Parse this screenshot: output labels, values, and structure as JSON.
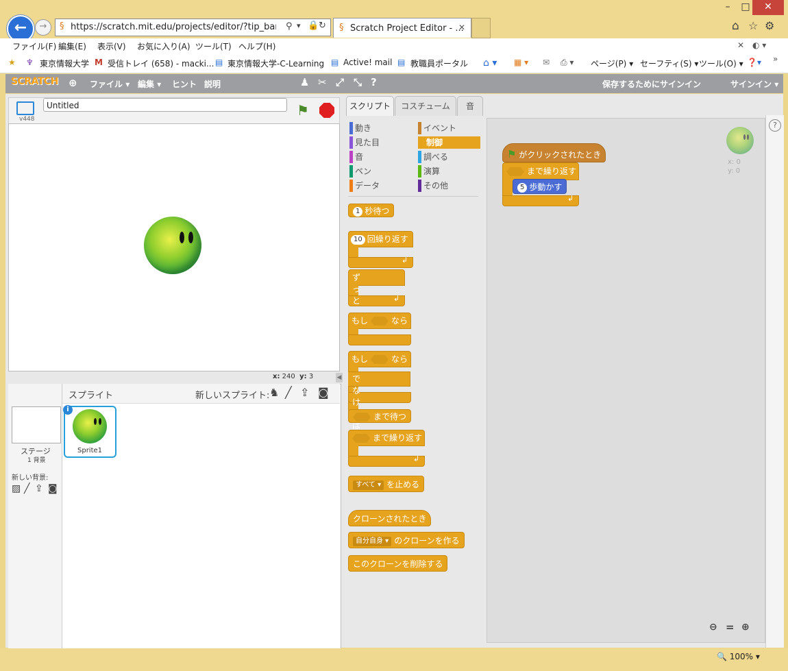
{
  "browser": {
    "address": "https://scratch.mit.edu/projects/editor/?tip_bar=get",
    "address_domain": "mit.edu",
    "tab_title": "Scratch Project Editor - ...",
    "zoom": "100%"
  },
  "menubar": [
    "ファイル(F)",
    "編集(E)",
    "表示(V)",
    "お気に入り(A)",
    "ツール(T)",
    "ヘルプ(H)"
  ],
  "favorites": [
    "東京情報大学",
    "受信トレイ (658) - macki...",
    "東京情報大学-C-Learning",
    "Active! mail",
    "教職員ポータル"
  ],
  "ie_commands": [
    "ページ(P)",
    "セーフティ(S)",
    "ツール(O)"
  ],
  "scratch_bar": {
    "logo": "SCRATCH",
    "file": "ファイル",
    "edit": "編集",
    "tips": "ヒント",
    "about": "説明",
    "save_signin": "保存するためにサインイン",
    "signin": "サインイン"
  },
  "stage": {
    "version": "v448",
    "project_title": "Untitled",
    "x_label": "x:",
    "x_value": "240",
    "y_label": "y:",
    "y_value": "3"
  },
  "sprites": {
    "header": "スプライト",
    "new_sprite": "新しいスプライト:",
    "stage_label": "ステージ",
    "backdrop_count": "1 背景",
    "new_backdrop": "新しい背景:",
    "sprite1": "Sprite1"
  },
  "tabs": [
    "スクリプト",
    "コスチューム",
    "音"
  ],
  "categories": [
    {
      "label": "動き",
      "color": "#4a6cd4"
    },
    {
      "label": "イベント",
      "color": "#c88330"
    },
    {
      "label": "見た目",
      "color": "#8a55d7"
    },
    {
      "label": "制御",
      "color": "#e6a31e"
    },
    {
      "label": "音",
      "color": "#bb42c3"
    },
    {
      "label": "調べる",
      "color": "#2ca5e2"
    },
    {
      "label": "ペン",
      "color": "#0e9a6c"
    },
    {
      "label": "演算",
      "color": "#5cb712"
    },
    {
      "label": "データ",
      "color": "#ee7d16"
    },
    {
      "label": "その他",
      "color": "#632d99"
    }
  ],
  "palette_blocks": {
    "wait_num": "1",
    "wait": "秒待つ",
    "repeat_num": "10",
    "repeat": "回繰り返す",
    "forever": "ずっと",
    "if": "もし",
    "then": "なら",
    "if2": "もし",
    "then2": "なら",
    "else": "でなければ",
    "wait_until": "まで待つ",
    "repeat_until": "まで繰り返す",
    "stop_option": "すべて",
    "stop": "を止める",
    "when_clone": "クローンされたとき",
    "clone_option": "自分自身",
    "create_clone": "のクローンを作る",
    "delete_clone": "このクローンを削除する"
  },
  "script": {
    "hat": "がクリックされたとき",
    "repeat_until": "まで繰り返す",
    "move_num": "5",
    "move": "歩動かす"
  },
  "sprite_info": {
    "x": "x: 0",
    "y": "y: 0"
  }
}
